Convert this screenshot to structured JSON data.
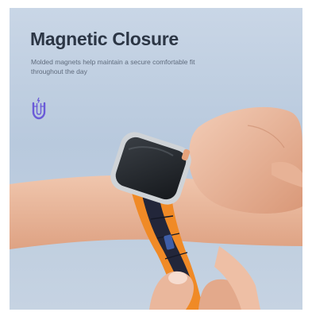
{
  "hero": {
    "title": "Magnetic Closure",
    "description": "Molded magnets help maintain a secure comfortable fit throughout the day",
    "icon": "magnet-icon"
  },
  "colors": {
    "background": "#c3d1e2",
    "title": "#2c3645",
    "description": "#5f6b7d",
    "icon": "#6a5ad8",
    "band_orange": "#f08a26",
    "band_navy": "#22263a"
  }
}
